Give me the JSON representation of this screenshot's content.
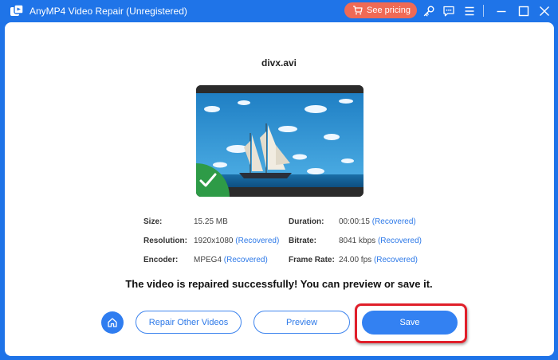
{
  "window": {
    "title": "AnyMP4 Video Repair (Unregistered)",
    "pricing_label": "See pricing",
    "icons": [
      "app-logo-icon",
      "cart-icon",
      "key-icon",
      "feedback-icon",
      "menu-icon",
      "minimize-icon",
      "maximize-icon",
      "close-icon"
    ]
  },
  "video": {
    "filename": "divx.avi",
    "status_icon": "checkmark-icon"
  },
  "info": {
    "size_label": "Size:",
    "size_value": "15.25 MB",
    "resolution_label": "Resolution:",
    "resolution_value": "1920x1080",
    "encoder_label": "Encoder:",
    "encoder_value": "MPEG4",
    "duration_label": "Duration:",
    "duration_value": "00:00:15",
    "bitrate_label": "Bitrate:",
    "bitrate_value": "8041 kbps",
    "framerate_label": "Frame Rate:",
    "framerate_value": "24.00 fps",
    "recovered_tag": "(Recovered)"
  },
  "message": "The video is repaired successfully! You can preview or save it.",
  "actions": {
    "home_icon": "home-icon",
    "repair_other_label": "Repair Other Videos",
    "preview_label": "Preview",
    "save_label": "Save"
  },
  "colors": {
    "titlebar": "#1f74e8",
    "pricing_button": "#f06a55",
    "accent": "#3381f2",
    "recovered_text": "#2d79e8",
    "success_badge": "#2e9b47",
    "highlight_box": "#e01f2a"
  }
}
